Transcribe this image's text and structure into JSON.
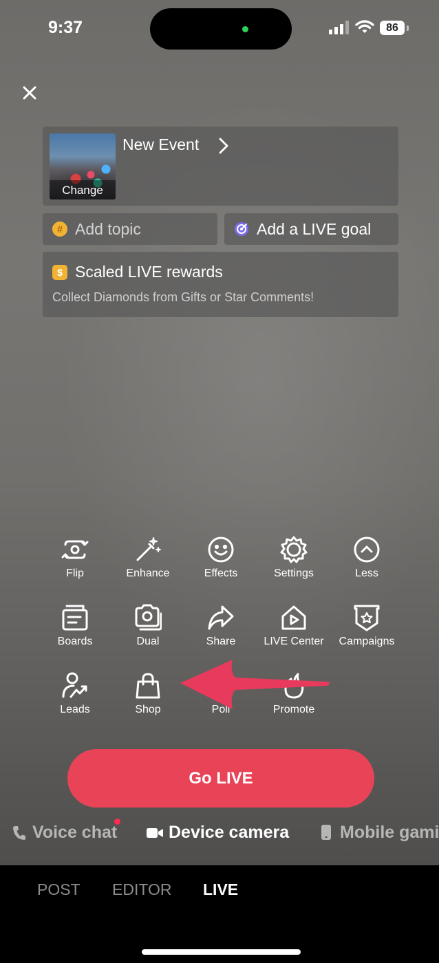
{
  "status_bar": {
    "time": "9:37",
    "battery": "86"
  },
  "event": {
    "cover_label": "Change",
    "title": "New Event"
  },
  "topic": {
    "icon": "#",
    "label": "Add topic"
  },
  "goal": {
    "label": "Add a LIVE goal"
  },
  "rewards": {
    "icon": "$",
    "title": "Scaled LIVE rewards",
    "subtitle": "Collect Diamonds from Gifts or Star Comments!"
  },
  "tools": {
    "flip": "Flip",
    "enhance": "Enhance",
    "effects": "Effects",
    "settings": "Settings",
    "less": "Less",
    "boards": "Boards",
    "dual": "Dual",
    "share": "Share",
    "live_center": "LIVE Center",
    "campaigns": "Campaigns",
    "leads": "Leads",
    "shop": "Shop",
    "poll": "Poll",
    "promote": "Promote"
  },
  "go_live": "Go LIVE",
  "modes": {
    "voice_chat": "Voice chat",
    "device_camera": "Device camera",
    "mobile_gaming": "Mobile gami"
  },
  "tabs": {
    "post": "POST",
    "editor": "EDITOR",
    "live": "LIVE"
  },
  "colors": {
    "accent": "#e94358",
    "notification": "#fe2c55"
  }
}
